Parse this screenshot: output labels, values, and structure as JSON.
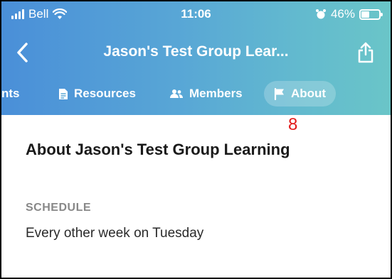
{
  "status_bar": {
    "carrier": "Bell",
    "time": "11:06",
    "battery_percent": "46%",
    "battery_level": 0.46
  },
  "navbar": {
    "title": "Jason's Test Group Lear..."
  },
  "tabs": [
    {
      "label": "nts",
      "icon": "none",
      "active": false
    },
    {
      "label": "Resources",
      "icon": "document-icon",
      "active": false
    },
    {
      "label": "Members",
      "icon": "people-icon",
      "active": false
    },
    {
      "label": "About",
      "icon": "flag-icon",
      "active": true
    }
  ],
  "annotation": {
    "number": "8",
    "color": "#e21a1a"
  },
  "content": {
    "title": "About Jason's Test Group Learning",
    "schedule_label": "SCHEDULE",
    "schedule_value": "Every other week on Tuesday"
  },
  "colors": {
    "header_gradient_start": "#4a8fd8",
    "header_gradient_end": "#6ac5c8",
    "text_dark": "#1a1a1a",
    "label_gray": "#888888"
  }
}
